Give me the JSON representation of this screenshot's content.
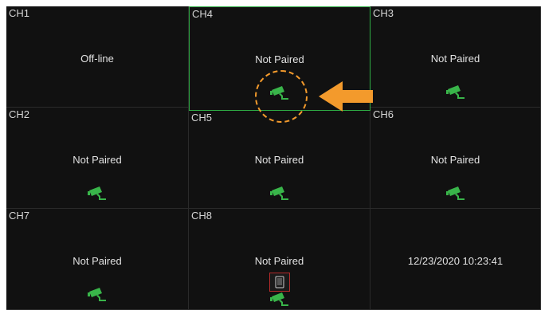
{
  "channels": [
    {
      "label": "CH1",
      "status": "Off-line"
    },
    {
      "label": "CH4",
      "status": "Not Paired"
    },
    {
      "label": "CH3",
      "status": "Not Paired"
    },
    {
      "label": "CH2",
      "status": "Not Paired"
    },
    {
      "label": "CH5",
      "status": "Not Paired"
    },
    {
      "label": "CH6",
      "status": "Not Paired"
    },
    {
      "label": "CH7",
      "status": "Not Paired"
    },
    {
      "label": "CH8",
      "status": "Not Paired"
    }
  ],
  "datetime": "12/23/2020 10:23:41",
  "icons": {
    "camera": "camera-icon",
    "arrow": "arrow-left-icon",
    "highlight": "dashed-circle-highlight",
    "thumbnail": "device-thumbnail-icon"
  },
  "colors": {
    "background": "#111111",
    "grid_line": "#2a2a2a",
    "selected_border": "#2fae45",
    "camera_icon": "#39b54a",
    "annotation": "#f39a2c",
    "text": "#e2e2e2"
  }
}
